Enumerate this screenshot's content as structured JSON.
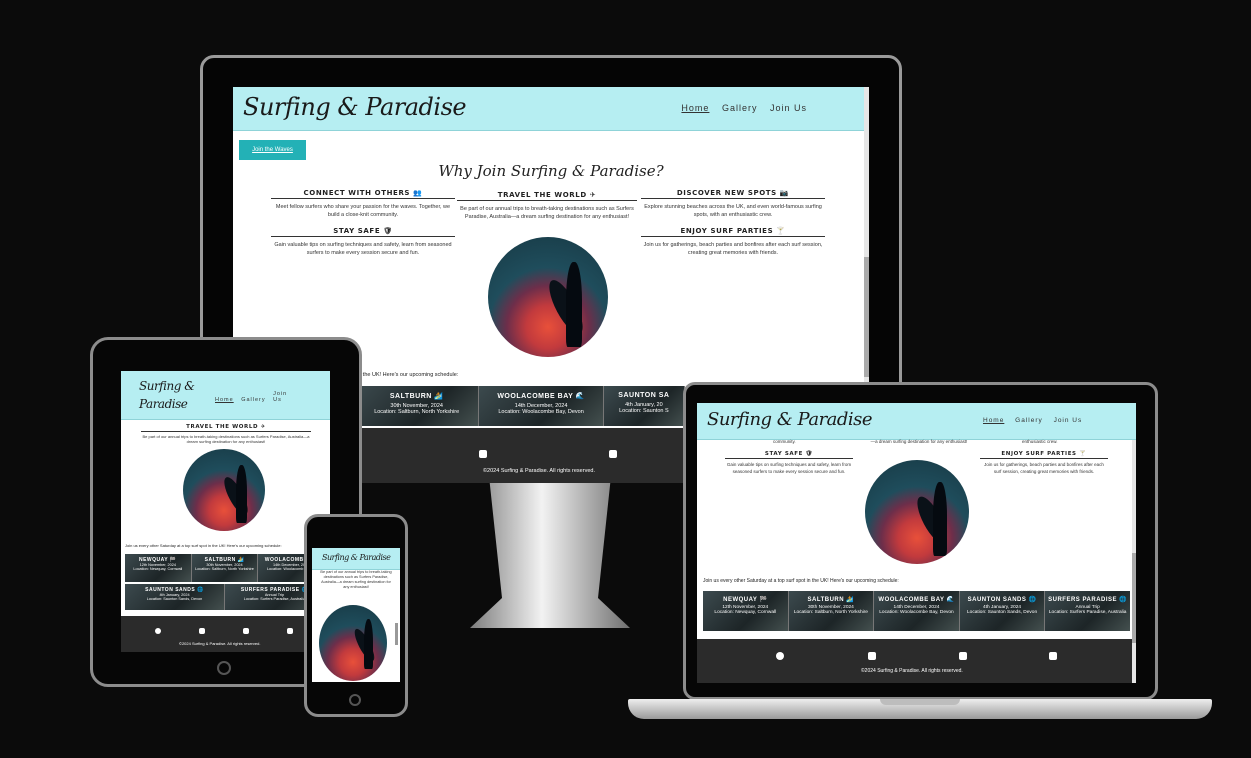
{
  "site": {
    "brand": "Surfing & Paradise",
    "nav": [
      "Home",
      "Gallery",
      "Join Us"
    ],
    "cta": "Join the Waves",
    "section_title": "Why Join Surfing & Paradise?",
    "features": [
      {
        "title": "CONNECT WITH OTHERS 👥",
        "text": "Meet fellow surfers who share your passion for the waves. Together, we build a close-knit community."
      },
      {
        "title": "TRAVEL THE WORLD ✈",
        "text": "Be part of our annual trips to breath-taking destinations such as Surfers Paradise, Australia—a dream surfing destination for any enthusiast!"
      },
      {
        "title": "DISCOVER NEW SPOTS 📷",
        "text": "Explore stunning beaches across the UK, and even world-famous surfing spots, with an enthusiastic crew."
      },
      {
        "title": "STAY SAFE 🛡",
        "text": "Gain valuable tips on surfing techniques and safety, learn from seasoned surfers to make every session secure and fun."
      },
      {
        "title": "ENJOY SURF PARTIES 🍸",
        "text": "Join us for gatherings, beach parties and bonfires after each surf session, creating great memories with friends."
      }
    ],
    "schedule_intro": "Join us every other Saturday at a top surf spot in the UK! Here's our upcoming schedule:",
    "schedule_intro_fragment": "in the UK! Here's our upcoming schedule:",
    "events": [
      {
        "name": "NEWQUAY 🏁",
        "date": "12th November, 2024",
        "loc": "Location: Newquay, Cornwall"
      },
      {
        "name": "SALTBURN 🏄",
        "date": "30th November, 2024",
        "loc": "Location: Saltburn, North Yorkshire"
      },
      {
        "name": "WOOLACOMBE BAY 🌊",
        "date": "14th December, 2024",
        "loc": "Location: Woolacombe Bay, Devon"
      },
      {
        "name": "SAUNTON SANDS 🌐",
        "date": "4th January, 2024",
        "loc": "Location: Saunton Sands, Devon"
      },
      {
        "name": "SURFERS PARADISE 🌐",
        "date": "Annual Trip",
        "loc": "Location: Surfers Paradise, Australia"
      }
    ],
    "copyright": "©2024 Surfing & Paradise. All rights reserved.",
    "partial_text": {
      "laptop_top_left": "community.",
      "laptop_top_mid": "—a dream surfing destination for any enthusiast!",
      "laptop_top_right": "enthusiastic crew.",
      "monitor_saunton_cut": "SAUNTON SA",
      "monitor_saunton_date_cut": "4th January, 20",
      "monitor_saunton_loc_cut": "Location: Saunton S",
      "tablet_woolacombe_cut": "WOOLACOMBE BA",
      "tablet_woolacombe_loc_cut": "Location: Woolacomb Devon",
      "phone_text": "Be part of our annual trips to breath-taking destinations such as Surfers Paradise, Australia—a dream surfing destination for any enthusiast!"
    }
  },
  "icons": [
    "facebook-icon",
    "twitter-icon",
    "youtube-icon",
    "instagram-icon"
  ],
  "colors": {
    "header": "#b6eef2",
    "button": "#23b1b6",
    "footer": "#2b2b2b",
    "background": "#0b0b0b"
  }
}
